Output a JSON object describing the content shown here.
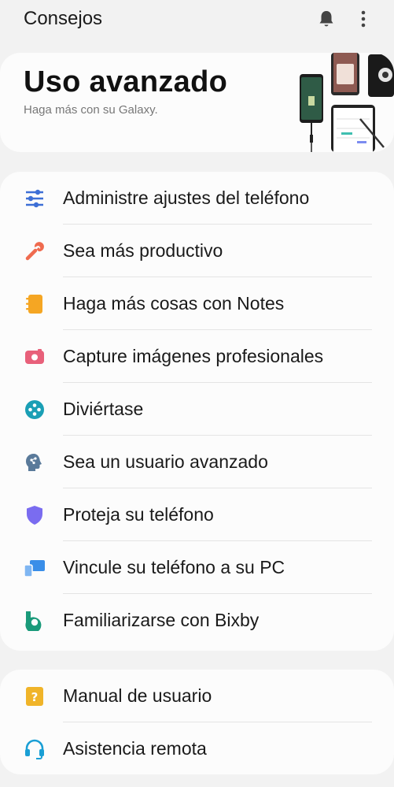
{
  "header": {
    "title": "Consejos",
    "icons": [
      "bell-icon",
      "more-vertical-icon"
    ]
  },
  "hero": {
    "title": "Uso avanzado",
    "subtitle": "Haga más con su Galaxy."
  },
  "main_menu": {
    "items": [
      {
        "label": "Administre ajustes del teléfono",
        "icon": "sliders-icon",
        "color": "#3d6fd6"
      },
      {
        "label": "Sea más productivo",
        "icon": "wrench-icon",
        "color": "#ef6b4f"
      },
      {
        "label": "Haga más cosas con Notes",
        "icon": "notebook-icon",
        "color": "#f5a623"
      },
      {
        "label": "Capture imágenes profesionales",
        "icon": "camera-icon",
        "color": "#e8607a"
      },
      {
        "label": "Diviértase",
        "icon": "gamepad-icon",
        "color": "#1a9fb5"
      },
      {
        "label": "Sea un usuario avanzado",
        "icon": "brain-head-icon",
        "color": "#5a7a9a"
      },
      {
        "label": "Proteja su teléfono",
        "icon": "shield-icon",
        "color": "#7a6cf0"
      },
      {
        "label": "Vincule su teléfono a su PC",
        "icon": "phone-pc-link-icon",
        "color": "#3a8ee8"
      },
      {
        "label": "Familiarizarse con Bixby",
        "icon": "bixby-icon",
        "color": "#1a9a7a"
      }
    ]
  },
  "support_menu": {
    "items": [
      {
        "label": "Manual de usuario",
        "icon": "help-book-icon",
        "color": "#f0b429"
      },
      {
        "label": "Asistencia remota",
        "icon": "headset-icon",
        "color": "#1a9fd5"
      }
    ]
  }
}
